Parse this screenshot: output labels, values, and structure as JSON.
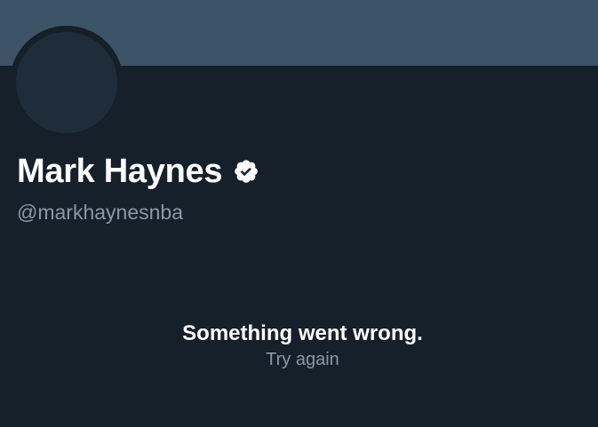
{
  "profile": {
    "display_name": "Mark Haynes",
    "handle": "@markhaynesnba",
    "verified": true
  },
  "error": {
    "message": "Something went wrong.",
    "retry_label": "Try again"
  },
  "colors": {
    "background": "#15202b",
    "banner": "#3d5466",
    "avatar_placeholder": "#1f2d3b",
    "primary_text": "#ffffff",
    "secondary_text": "#8b98a5"
  },
  "icons": {
    "verified": "verified-badge-icon"
  }
}
